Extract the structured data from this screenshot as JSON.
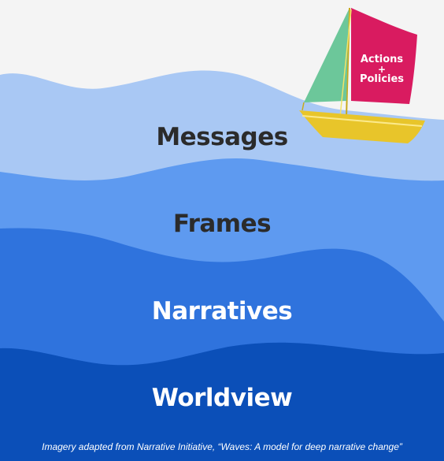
{
  "layers": {
    "messages": "Messages",
    "frames": "Frames",
    "narratives": "Narratives",
    "worldview": "Worldview"
  },
  "boat": {
    "sail_line1": "Actions",
    "sail_plus": "+",
    "sail_line2": "Policies"
  },
  "caption": "Imagery adapted from Narrative Initiative, “Waves: A model for deep narrative change”",
  "colors": {
    "background": "#f4f4f4",
    "layer_messages": "#a9c8f4",
    "layer_frames": "#5e9af0",
    "layer_narratives": "#2f73dd",
    "layer_worldview": "#0b4fb8",
    "sail_left": "#6cc79a",
    "sail_right": "#d91b60",
    "hull": "#e8c52a"
  }
}
